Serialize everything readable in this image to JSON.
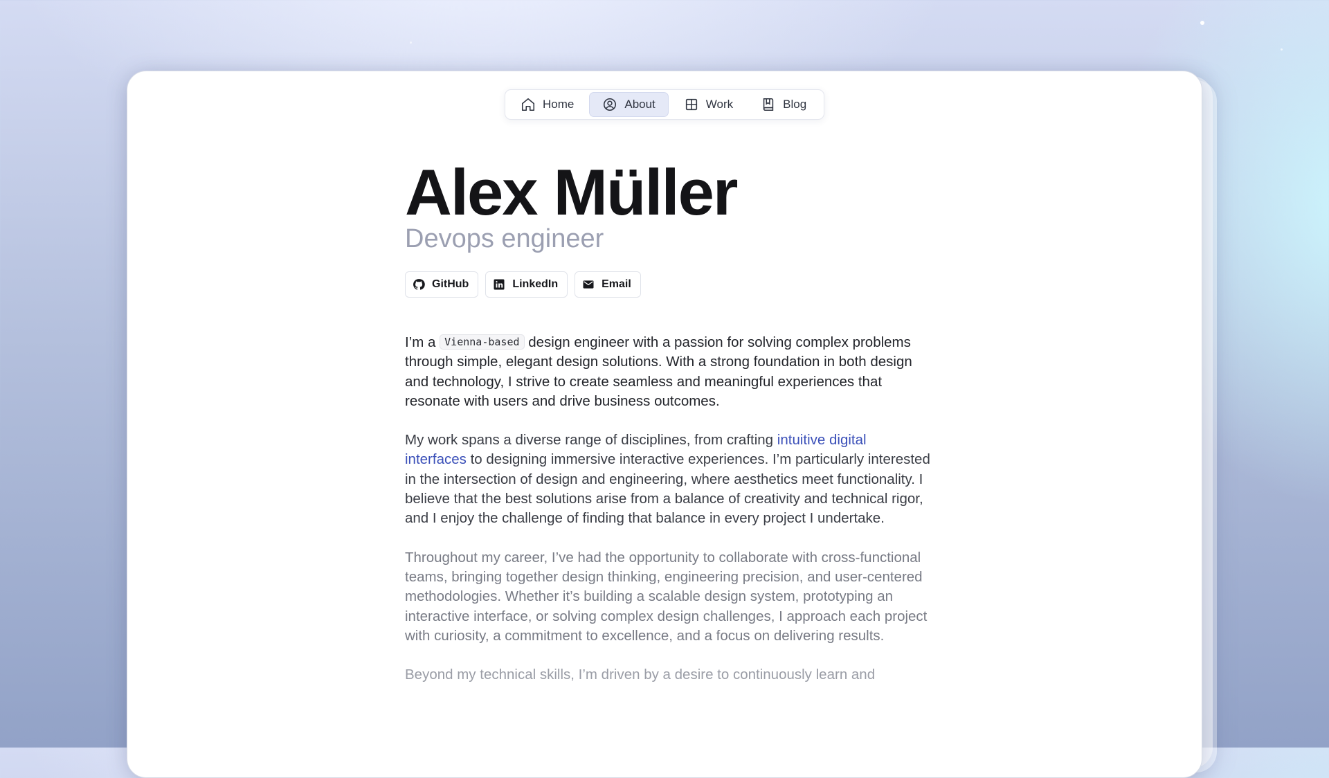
{
  "nav": {
    "items": [
      {
        "label": "Home",
        "icon": "home-icon"
      },
      {
        "label": "About",
        "icon": "user-circle-icon",
        "active": true
      },
      {
        "label": "Work",
        "icon": "grid-icon"
      },
      {
        "label": "Blog",
        "icon": "book-icon"
      }
    ]
  },
  "profile": {
    "name": "Alex Müller",
    "role": "Devops engineer"
  },
  "socials": [
    {
      "label": "GitHub",
      "icon": "github-icon"
    },
    {
      "label": "LinkedIn",
      "icon": "linkedin-icon"
    },
    {
      "label": "Email",
      "icon": "mail-icon"
    }
  ],
  "about": {
    "p1_prefix": "I’m a",
    "p1_code": "Vienna-based",
    "p1_rest": "design engineer with a passion for solving complex problems through simple, elegant design solutions. With a strong foundation in both design and technology, I strive to create seamless and meaningful experiences that resonate with users and drive business outcomes.",
    "p2_prefix": "My work spans a diverse range of disciplines, from crafting",
    "p2_link": "intuitive digital interfaces",
    "p2_rest": "to designing immersive interactive experiences. I’m particularly interested in the intersection of design and engineering, where aesthetics meet functionality. I believe that the best solutions arise from a balance of creativity and technical rigor, and I enjoy the challenge of finding that balance in every project I undertake.",
    "p3": "Throughout my career, I’ve had the opportunity to collaborate with cross-functional teams, bringing together design thinking, engineering precision, and user-centered methodologies. Whether it’s building a scalable design system, prototyping an interactive interface, or solving complex design challenges, I approach each project with curiosity, a commitment to excellence, and a focus on delivering results.",
    "p4": "Beyond my technical skills, I’m driven by a desire to continuously learn and"
  },
  "colors": {
    "accent_link": "#3a4fb8",
    "active_nav_bg": "#e5e9f7"
  }
}
